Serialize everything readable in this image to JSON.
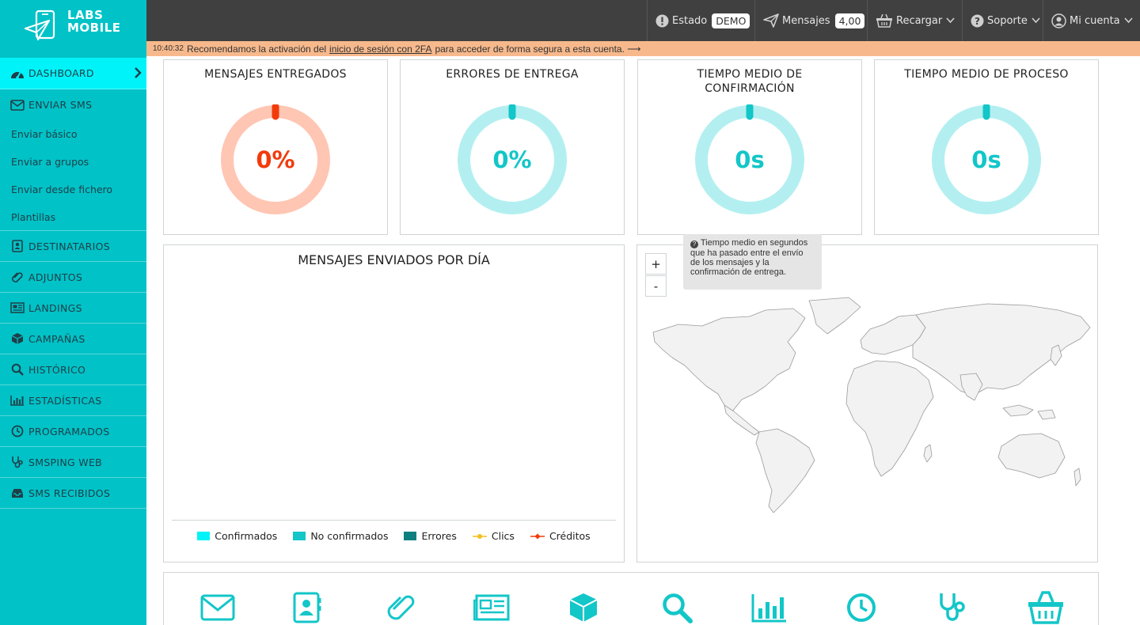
{
  "brand": {
    "line1": "LABS",
    "line2": "MOBILE"
  },
  "colors": {
    "accent": "#00c2c7",
    "active": "#00f3f9",
    "error_red": "#f23b0c",
    "teal": "#13c6c8"
  },
  "sidebar": {
    "items": [
      {
        "label": "DASHBOARD",
        "icon": "dashboard-icon",
        "active": true
      },
      {
        "label": "ENVIAR SMS",
        "icon": "envelope-icon"
      },
      {
        "label": "DESTINATARIOS",
        "icon": "contacts-icon"
      },
      {
        "label": "ADJUNTOS",
        "icon": "paperclip-icon"
      },
      {
        "label": "LANDINGS",
        "icon": "newspaper-icon"
      },
      {
        "label": "CAMPAÑAS",
        "icon": "cube-icon"
      },
      {
        "label": "HISTÓRICO",
        "icon": "search-icon"
      },
      {
        "label": "ESTADÍSTICAS",
        "icon": "bar-chart-icon"
      },
      {
        "label": "PROGRAMADOS",
        "icon": "clock-icon"
      },
      {
        "label": "SMSPING WEB",
        "icon": "stethoscope-icon"
      },
      {
        "label": "SMS RECIBIDOS",
        "icon": "inbox-icon"
      }
    ],
    "subitems": [
      "Enviar básico",
      "Enviar a grupos",
      "Enviar desde fichero",
      "Plantillas"
    ]
  },
  "topbar": {
    "estado_label": "Estado",
    "estado_badge": "DEMO",
    "mensajes_label": "Mensajes",
    "mensajes_badge": "4,00",
    "recargar_label": "Recargar",
    "soporte_label": "Soporte",
    "cuenta_label": "Mi cuenta"
  },
  "alert": {
    "time": "10:40:32",
    "text_before": "Recomendamos la activación del",
    "link": "inicio de sesión con 2FA",
    "text_after": "para acceder de forma segura a esta cuenta. ⟶"
  },
  "stats": [
    {
      "title": "MENSAJES ENTREGADOS",
      "value": "0%",
      "level": 0
    },
    {
      "title": "ERRORES DE ENTREGA",
      "value": "0%",
      "level": 0
    },
    {
      "title": "TIEMPO MEDIO DE CONFIRMACIÓN",
      "value": "0s",
      "level": 0
    },
    {
      "title": "TIEMPO MEDIO DE PROCESO",
      "value": "0s",
      "level": 0
    }
  ],
  "chart": {
    "title": "MENSAJES ENVIADOS POR DÍA",
    "legend": [
      {
        "label": "Confirmados",
        "color": "#00f3f9"
      },
      {
        "label": "No confirmados",
        "color": "#13c6c8"
      },
      {
        "label": "Errores",
        "color": "#0e7f7f"
      },
      {
        "label": "Clics",
        "color": "#f2c01e"
      },
      {
        "label": "Créditos",
        "color": "#f23b0c"
      }
    ]
  },
  "map": {
    "zoom_in": "+",
    "zoom_out": "-"
  },
  "tooltip": {
    "text": "Tiempo medio en segundos que ha pasado entre el envío de los mensajes y la confirmación de entrega."
  },
  "strip_icons": [
    "envelope-icon",
    "contacts-icon",
    "paperclip-icon",
    "newspaper-icon",
    "cube-icon",
    "search-icon",
    "bar-chart-icon",
    "clock-icon",
    "stethoscope-icon",
    "basket-icon"
  ]
}
